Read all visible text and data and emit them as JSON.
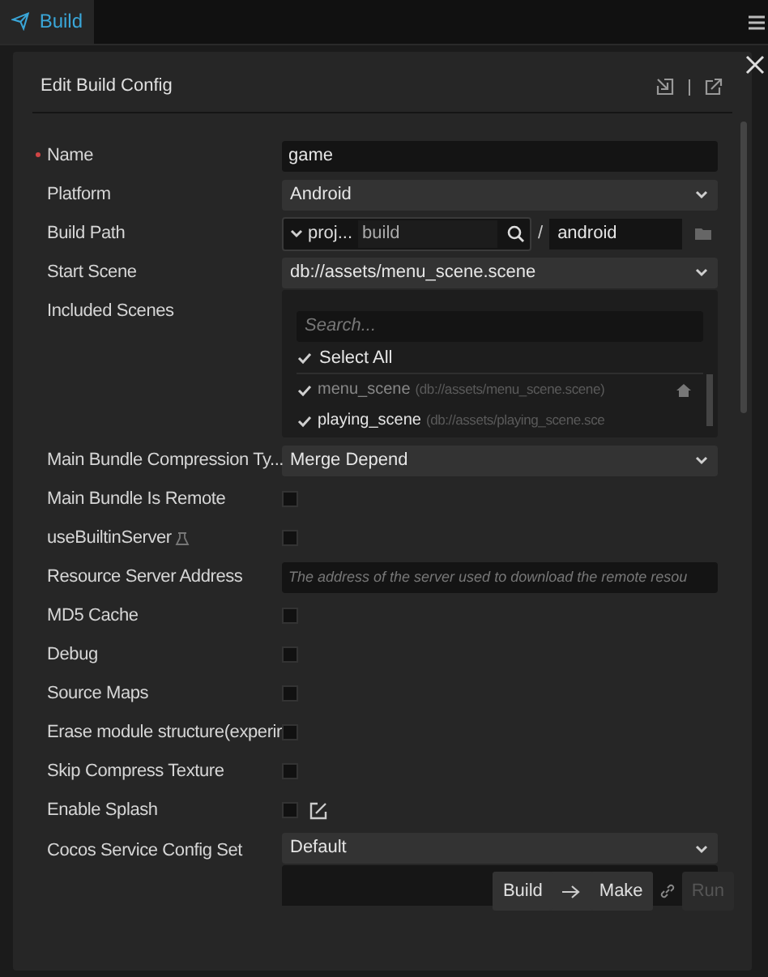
{
  "tabs": [
    {
      "label": "Build",
      "selected": true
    }
  ],
  "dialog": {
    "title": "Edit Build Config"
  },
  "fields": [
    {
      "kind": "text",
      "label": "Name",
      "required": true,
      "value": "game"
    },
    {
      "kind": "select",
      "label": "Platform",
      "value": "Android"
    },
    {
      "kind": "path",
      "label": "Build Path",
      "prefix": "proj...",
      "value": "build",
      "separator": "/",
      "subdir": "android"
    },
    {
      "kind": "select",
      "label": "Start Scene",
      "value": "db://assets/menu_scene.scene"
    },
    {
      "kind": "scenes",
      "label": "Included Scenes",
      "placeholder": "Search...",
      "select_all": {
        "label": "Select All",
        "checked": true
      },
      "scenes": [
        {
          "name": "menu_scene",
          "path": "(db://assets/menu_scene.scene)",
          "checked": true,
          "disabled": true
        },
        {
          "name": "playing_scene",
          "path": "(db://assets/playing_scene.sce",
          "checked": true,
          "disabled": false
        }
      ]
    },
    {
      "kind": "select",
      "label": "Main Bundle Compression Ty...",
      "value": "Merge Depend"
    },
    {
      "kind": "checkbox",
      "label": "Main Bundle Is Remote",
      "checked": false
    },
    {
      "kind": "checkbox",
      "label": "useBuiltinServer",
      "checked": false,
      "experimental": true
    },
    {
      "kind": "text",
      "label": "Resource Server Address",
      "placeholder": "The address of the server used to download the remote resou"
    },
    {
      "kind": "checkbox",
      "label": "MD5 Cache",
      "checked": false
    },
    {
      "kind": "checkbox",
      "label": "Debug",
      "checked": false
    },
    {
      "kind": "checkbox",
      "label": "Source Maps",
      "checked": false
    },
    {
      "kind": "checkbox",
      "label": "Erase module structure(experir",
      "checked": false
    },
    {
      "kind": "checkbox",
      "label": "Skip Compress Texture",
      "checked": false
    },
    {
      "kind": "checkbox",
      "label": "Enable Splash",
      "checked": false,
      "editable": true
    },
    {
      "kind": "select",
      "label": "Cocos Service Config Set",
      "value": "Default",
      "details": true
    }
  ],
  "actions": [
    {
      "label": "Build",
      "disabled": false
    },
    {
      "label": "Make",
      "disabled": false
    },
    {
      "label": "Run",
      "disabled": true
    }
  ]
}
